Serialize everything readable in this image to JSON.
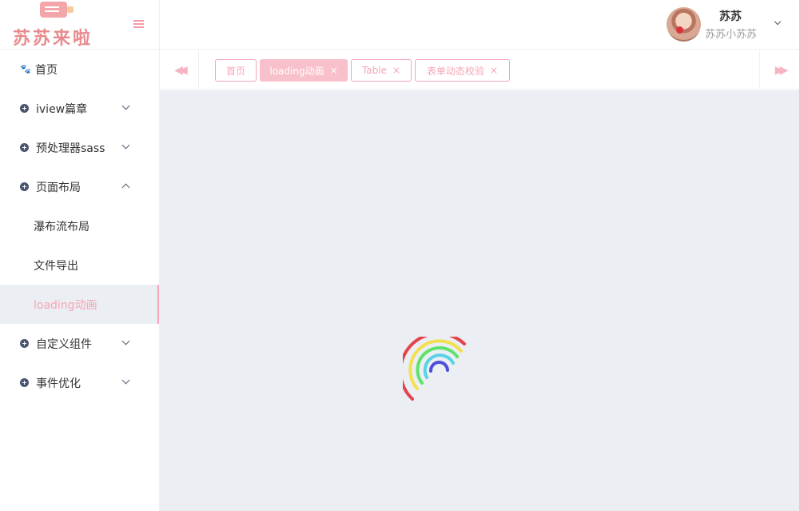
{
  "logo": {
    "text": "苏苏来啦"
  },
  "sidebar": {
    "items": [
      {
        "label": "首页"
      },
      {
        "label": "iview篇章"
      },
      {
        "label": "预处理器sass"
      },
      {
        "label": "页面布局"
      },
      {
        "label": "自定义组件"
      },
      {
        "label": "事件优化"
      }
    ],
    "subitems": [
      {
        "label": "瀑布流布局"
      },
      {
        "label": "文件导出"
      },
      {
        "label": "loading动画"
      }
    ]
  },
  "header": {
    "user_name": "苏苏",
    "user_nick": "苏苏小苏苏"
  },
  "tags": [
    {
      "label": "首页",
      "closable": false
    },
    {
      "label": "loading动画",
      "closable": true,
      "active": true
    },
    {
      "label": "Table",
      "closable": true
    },
    {
      "label": "表单动态校验",
      "closable": true
    }
  ],
  "tags_nav": {
    "prev": "◀◀",
    "next": "▶▶",
    "close": "×"
  },
  "colors": {
    "accent": "#f6a5b6",
    "content_bg": "#ebeef2",
    "spinner": [
      "#e5424d",
      "#f3e04f",
      "#5ee36a",
      "#58d3e6",
      "#4c4fd9"
    ]
  }
}
